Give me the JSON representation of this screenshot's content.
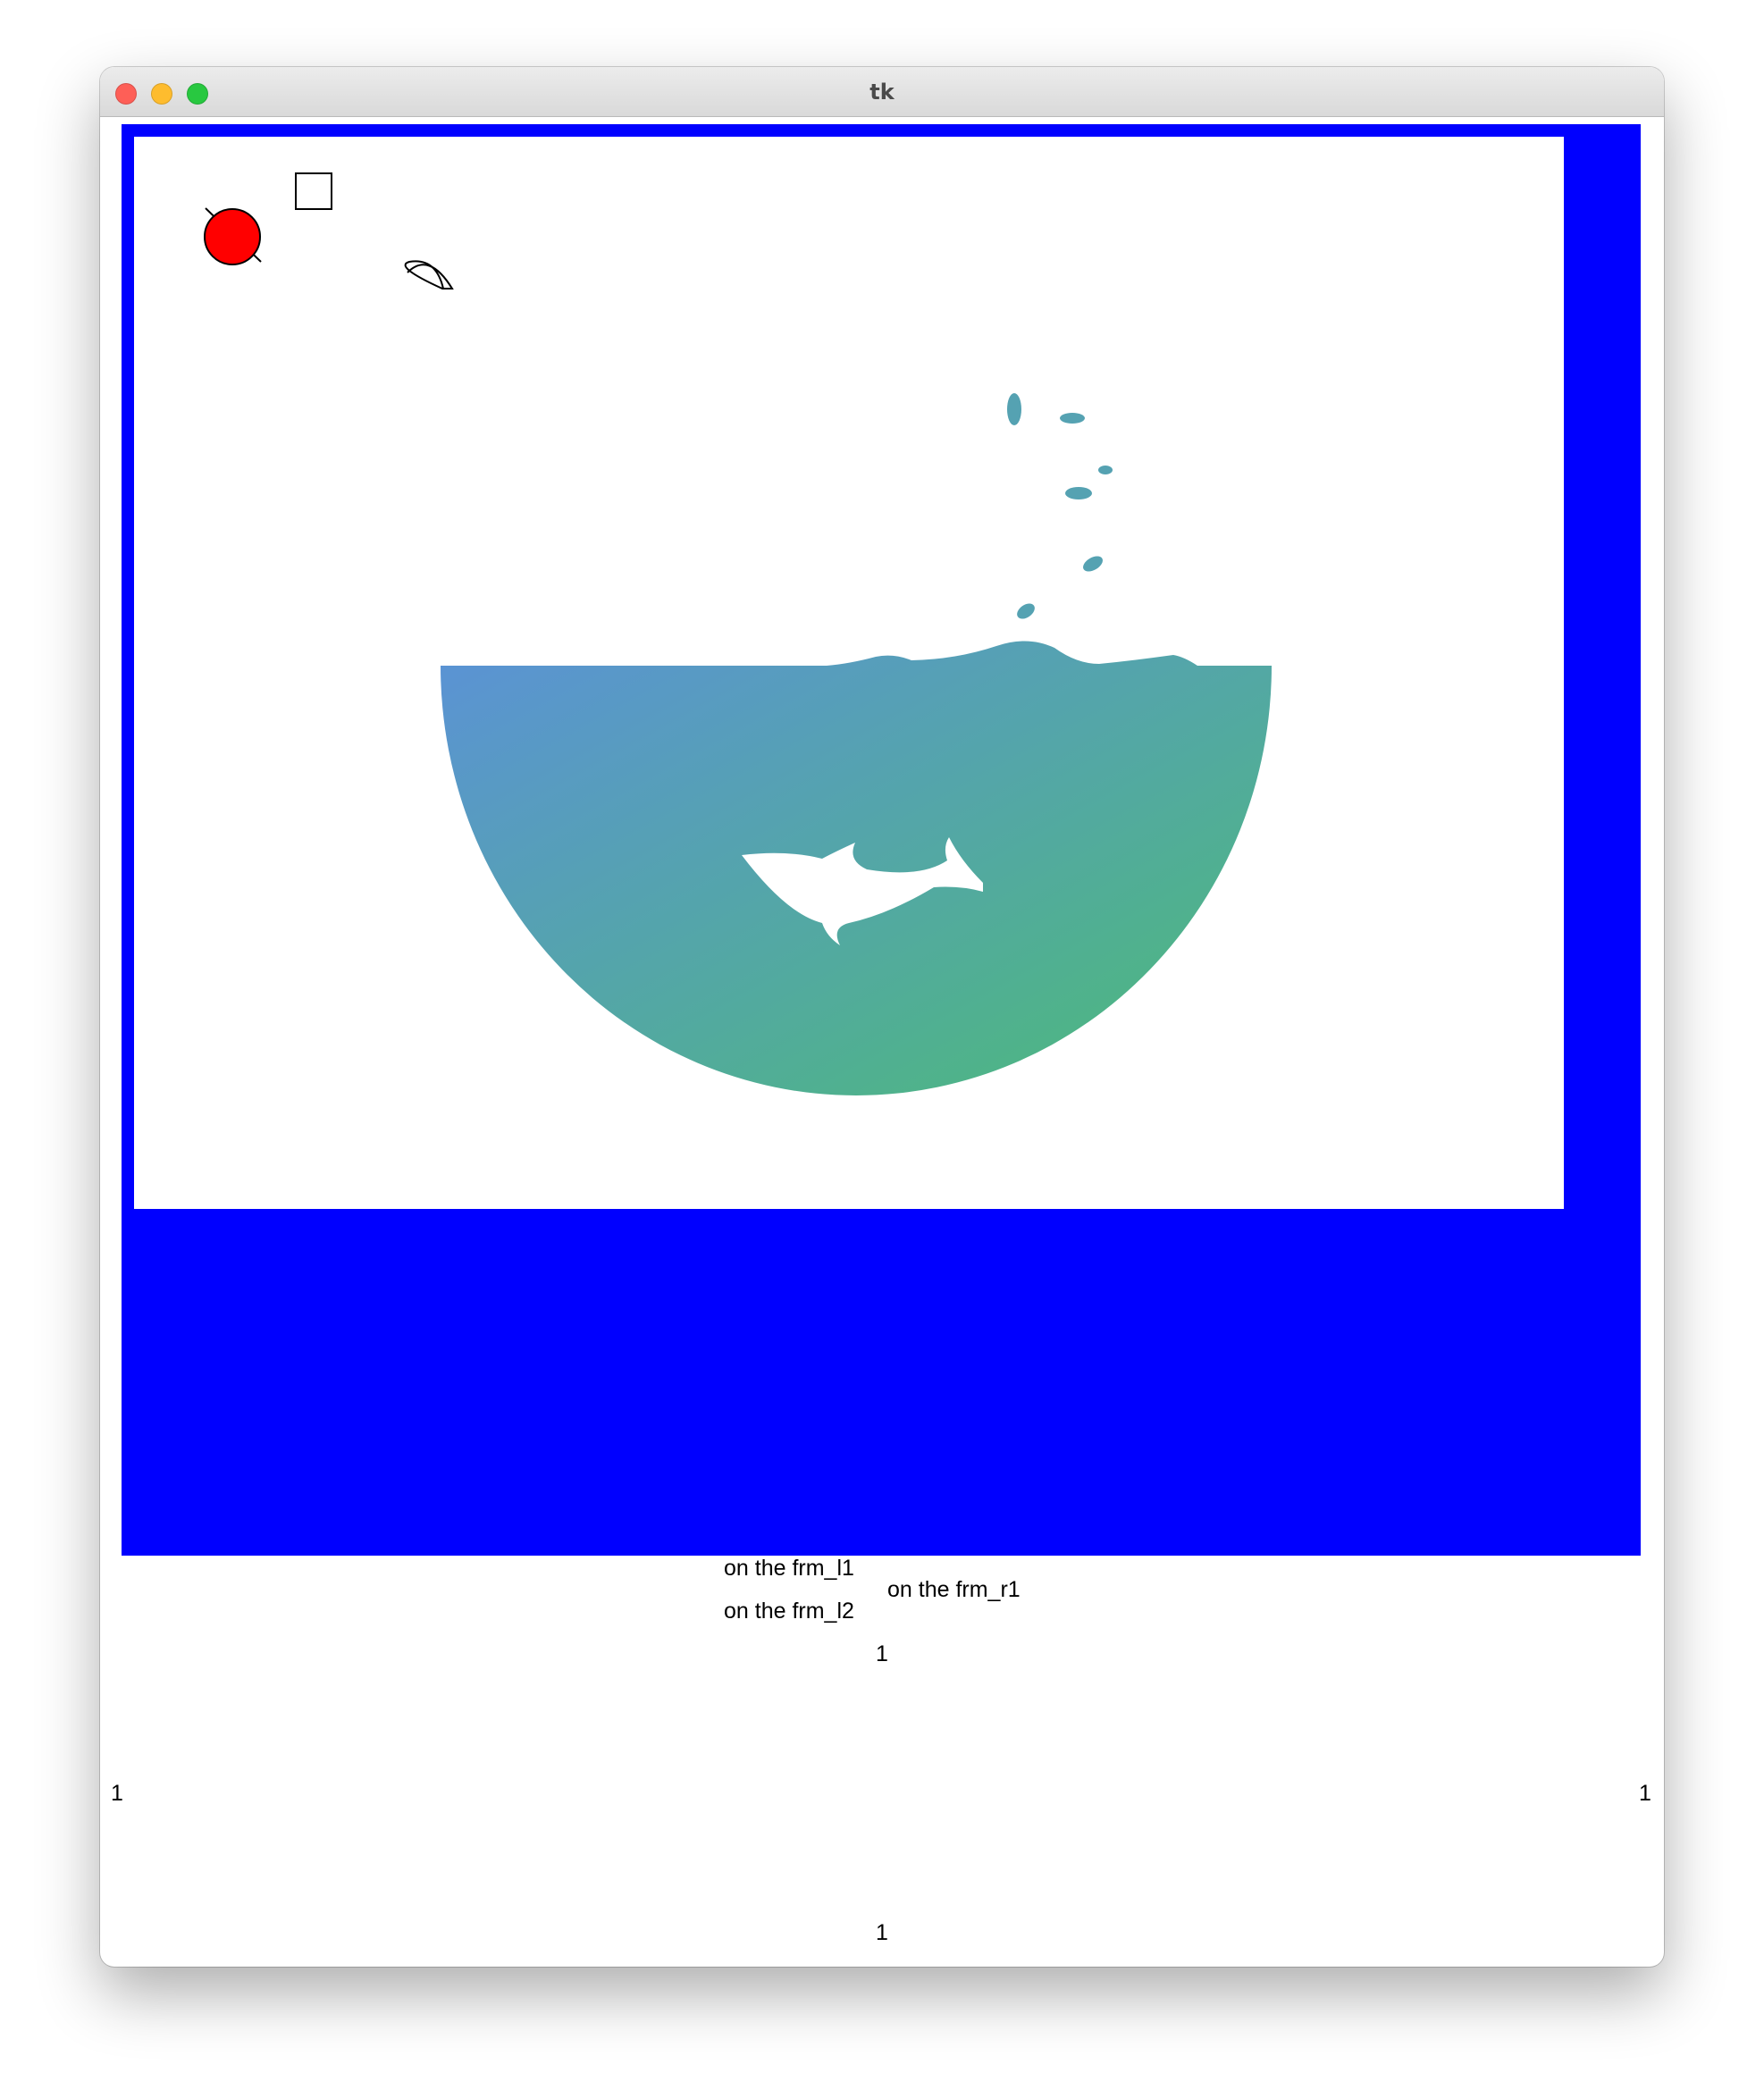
{
  "window": {
    "title": "tk",
    "traffic_lights": {
      "close_color": "#fe5f57",
      "minimize_color": "#febc2e",
      "maximize_color": "#28c840"
    }
  },
  "frame": {
    "background_color": "#0000ff"
  },
  "canvas": {
    "background_color": "#ffffff",
    "oval_fill": "#ff0000",
    "image_icon": "fishbowl-with-fish-illustration",
    "water_gradient": [
      "#5b92d6",
      "#4cbb77"
    ]
  },
  "labels": {
    "frm_l1": "on the frm_l1",
    "frm_l2": "on the frm_l2",
    "frm_r1": "on the frm_r1",
    "top": "1",
    "left": "1",
    "right": "1",
    "bottom": "1"
  }
}
